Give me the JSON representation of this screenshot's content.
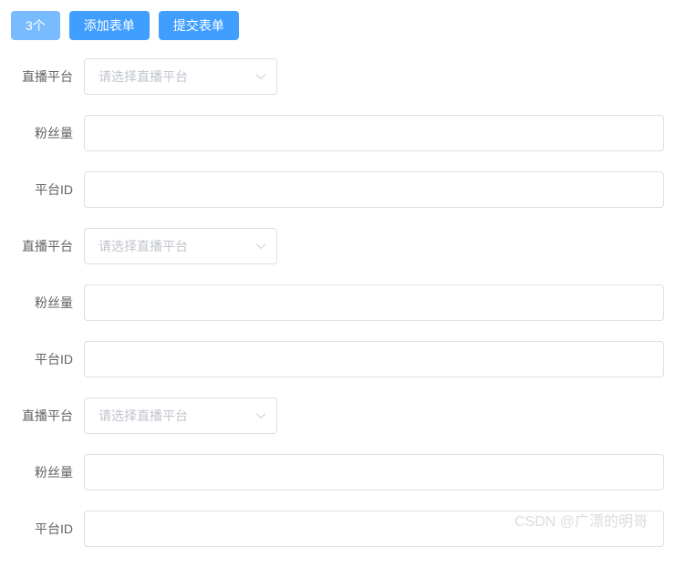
{
  "buttons": {
    "count": "3个",
    "add": "添加表单",
    "submit": "提交表单"
  },
  "labels": {
    "platform": "直播平台",
    "followers": "粉丝量",
    "platformId": "平台ID"
  },
  "placeholders": {
    "platform": "请选择直播平台"
  },
  "forms": [
    {
      "platform": "",
      "followers": "",
      "platformId": ""
    },
    {
      "platform": "",
      "followers": "",
      "platformId": ""
    },
    {
      "platform": "",
      "followers": "",
      "platformId": ""
    }
  ],
  "watermark": "CSDN @广漂的明哥"
}
